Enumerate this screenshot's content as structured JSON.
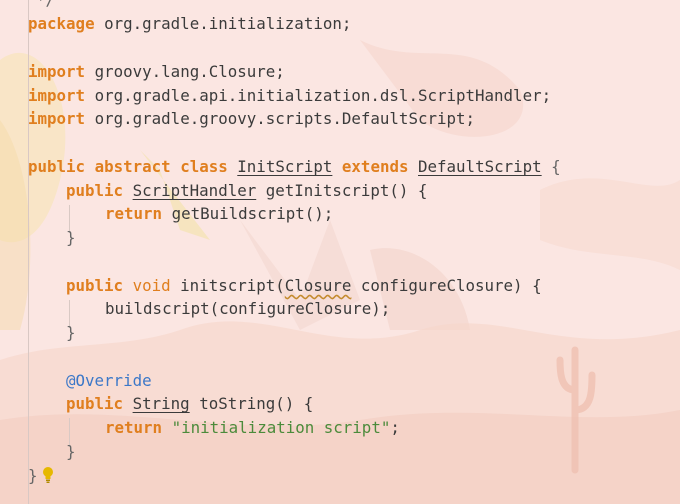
{
  "colors": {
    "background": "#fbe6e2",
    "keyword": "#e07f1f",
    "annotation": "#3c78c8",
    "string": "#4b8b3b",
    "text": "#3b3b3b",
    "bulb": "#e6b800"
  },
  "icons": {
    "intention_bulb": "lightbulb-icon"
  },
  "code": {
    "top_comment_fragment": "*/",
    "package": {
      "keyword": "package",
      "name": "org.gradle.initialization",
      "end": ";"
    },
    "imports": [
      {
        "keyword": "import",
        "path": "groovy.lang.Closure",
        "end": ";"
      },
      {
        "keyword": "import",
        "path": "org.gradle.api.initialization.dsl.ScriptHandler",
        "end": ";"
      },
      {
        "keyword": "import",
        "path": "org.gradle.groovy.scripts.DefaultScript",
        "end": ";"
      }
    ],
    "class_decl": {
      "mod1": "public",
      "mod2": "abstract",
      "mod3": "class",
      "name": "InitScript",
      "extends_kw": "extends",
      "parent": "DefaultScript",
      "open": "{"
    },
    "method1": {
      "mod": "public",
      "type": "ScriptHandler",
      "sig": "getInitscript() {",
      "return_kw": "return",
      "body": "getBuildscript();",
      "close": "}"
    },
    "method2": {
      "mod": "public",
      "type": "void",
      "sig_start": "initscript(",
      "param_type": "Closure",
      "sig_end": "configureClosure) {",
      "body": "buildscript(configureClosure);",
      "close": "}"
    },
    "method3": {
      "annotation": "@Override",
      "mod": "public",
      "type": "String",
      "sig": "toString() {",
      "return_kw": "return",
      "string_literal": "\"initialization script\"",
      "end": ";",
      "close": "}"
    },
    "class_close": "}"
  }
}
